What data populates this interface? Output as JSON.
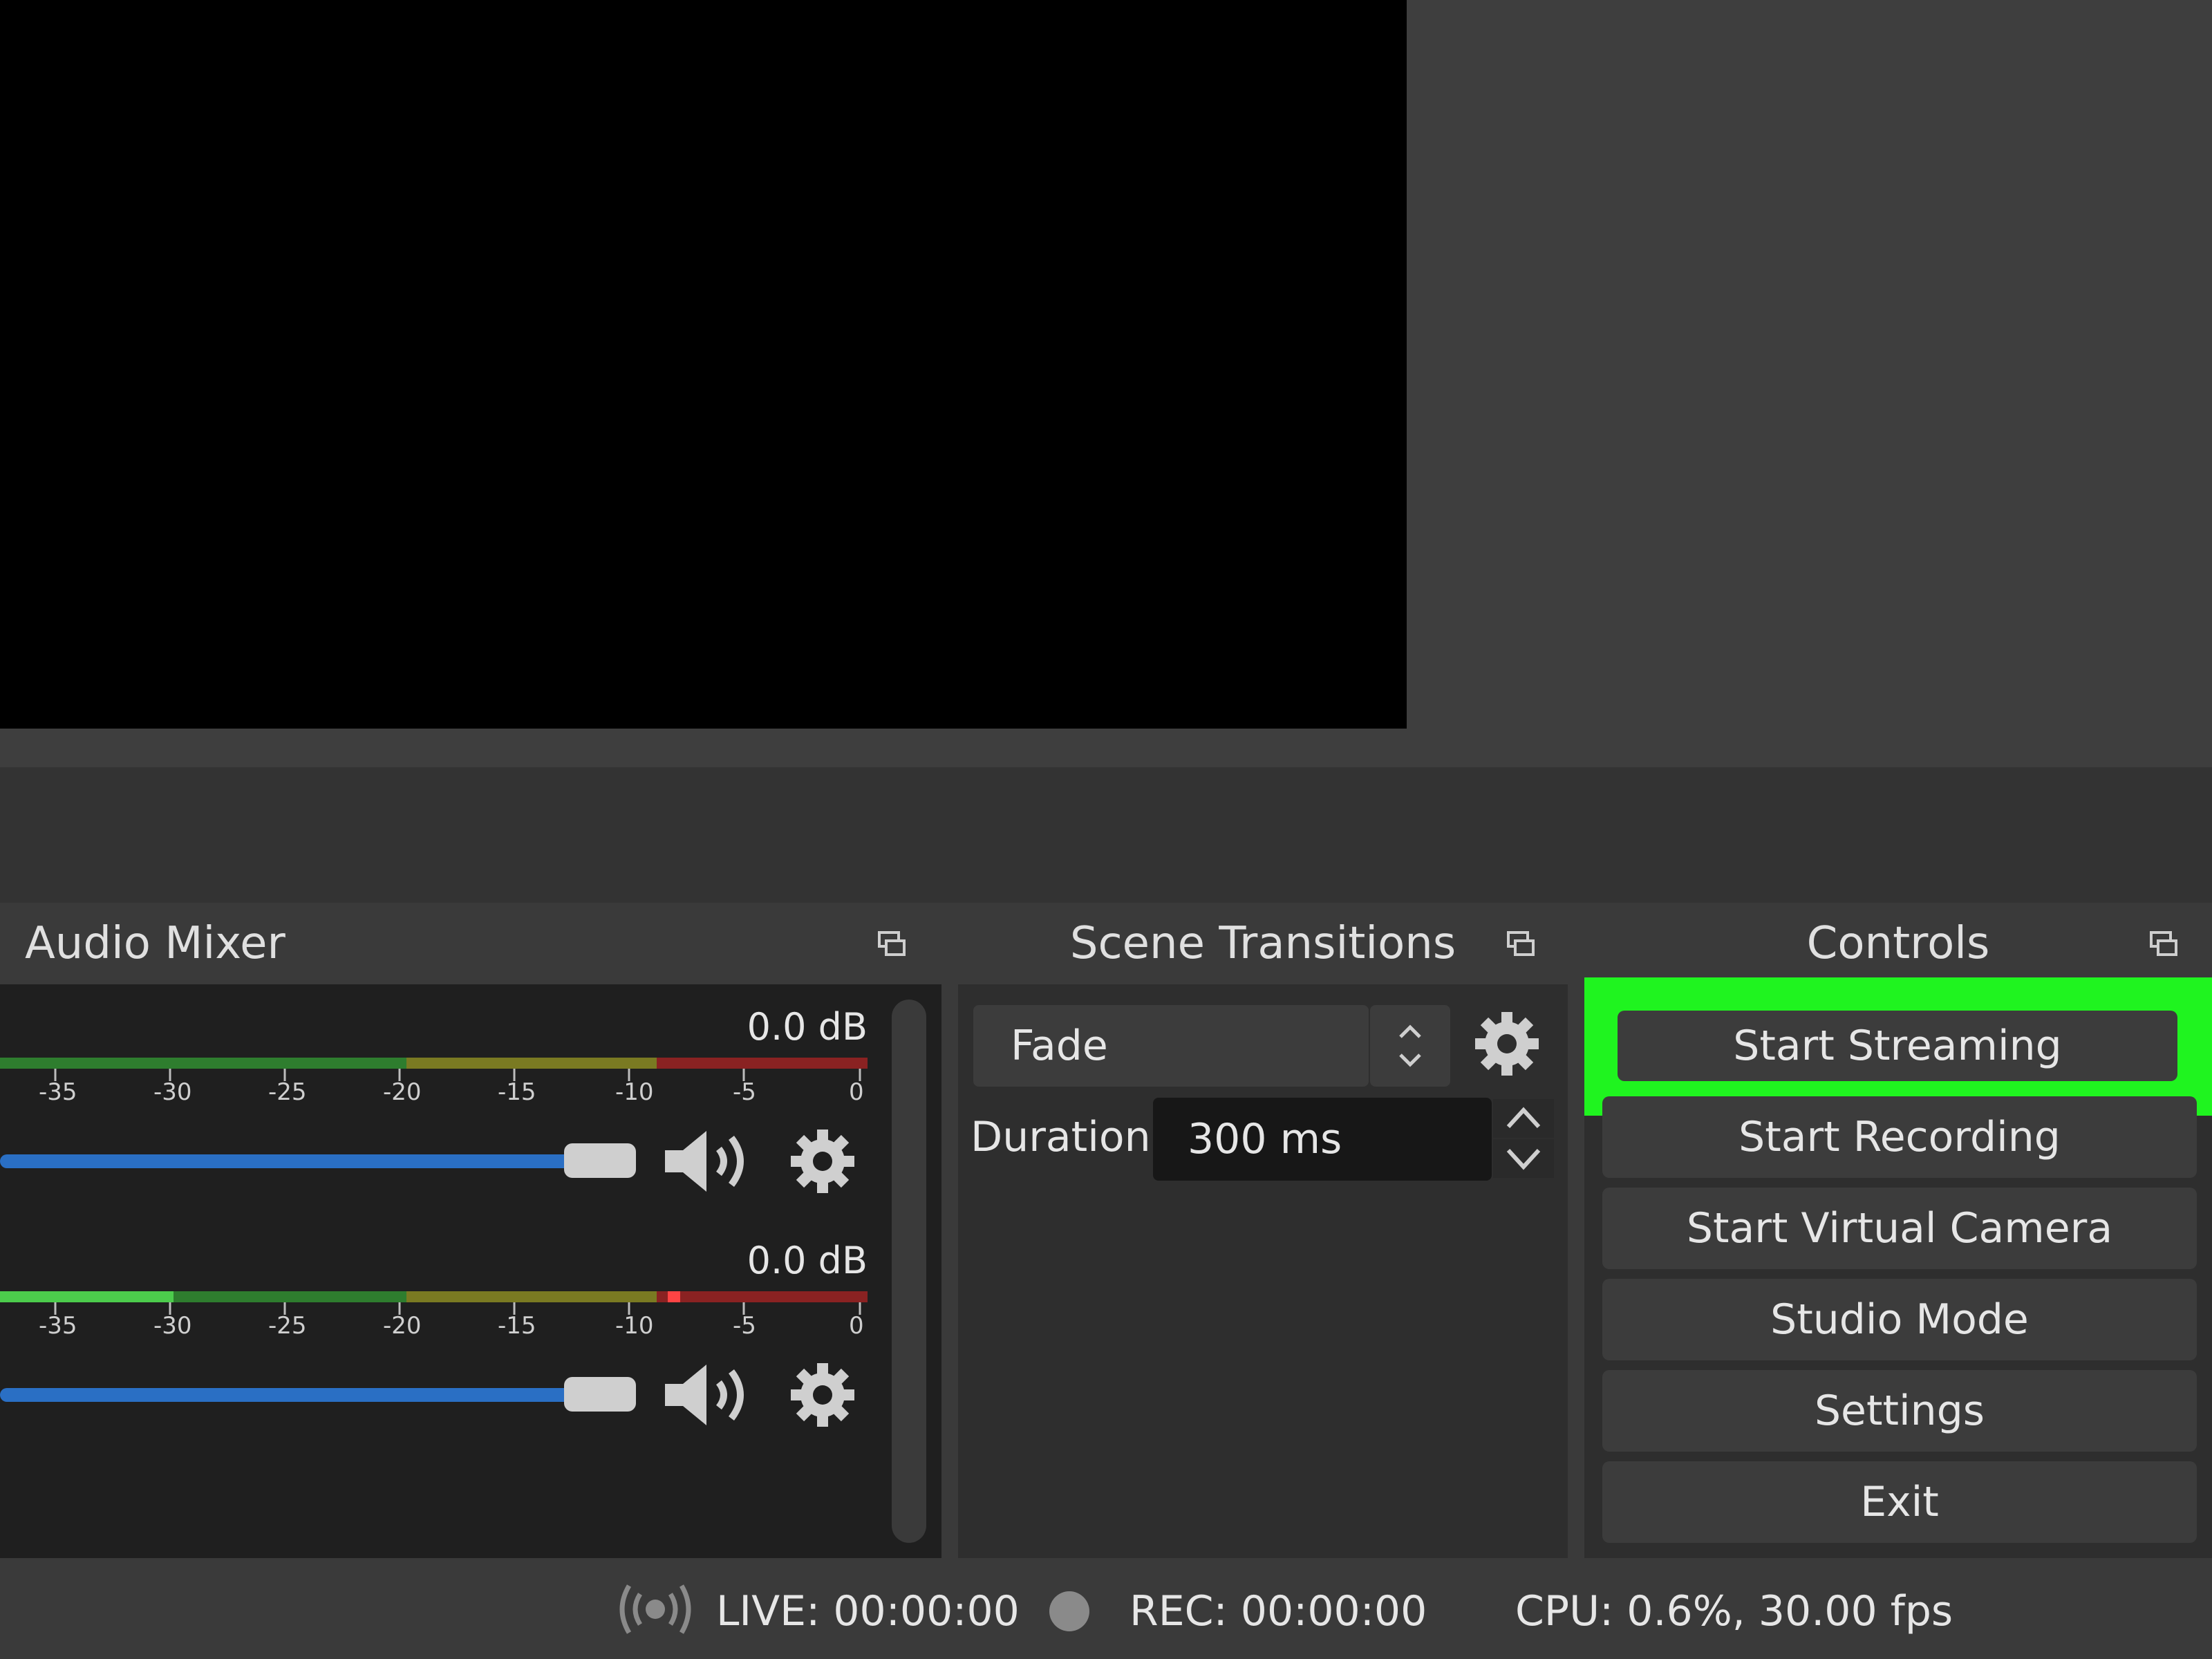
{
  "audio_mixer": {
    "title": "Audio Mixer",
    "channels": [
      {
        "db": "0.0 dB",
        "level_fraction": 0.0
      },
      {
        "db": "0.0 dB",
        "level_fraction": 0.2
      }
    ],
    "ticks": [
      "-35",
      "-30",
      "-25",
      "-20",
      "-15",
      "-10",
      "-5",
      "0"
    ]
  },
  "scene_transitions": {
    "title": "Scene Transitions",
    "selected": "Fade",
    "duration_label": "Duration",
    "duration_value": "300 ms"
  },
  "controls": {
    "title": "Controls",
    "buttons": [
      "Start Streaming",
      "Start Recording",
      "Start Virtual Camera",
      "Studio Mode",
      "Settings",
      "Exit"
    ],
    "highlight_color": "#1ff41f"
  },
  "status": {
    "live": "LIVE: 00:00:00",
    "rec": "REC: 00:00:00",
    "cpu": "CPU: 0.6%, 30.00 fps"
  },
  "colors": {
    "slider": "#2a6fc4",
    "meter_green": "#2e7d2e",
    "meter_yellow": "#7a7a22",
    "meter_red": "#8a2222",
    "meter_active": "#4ccc4c"
  }
}
